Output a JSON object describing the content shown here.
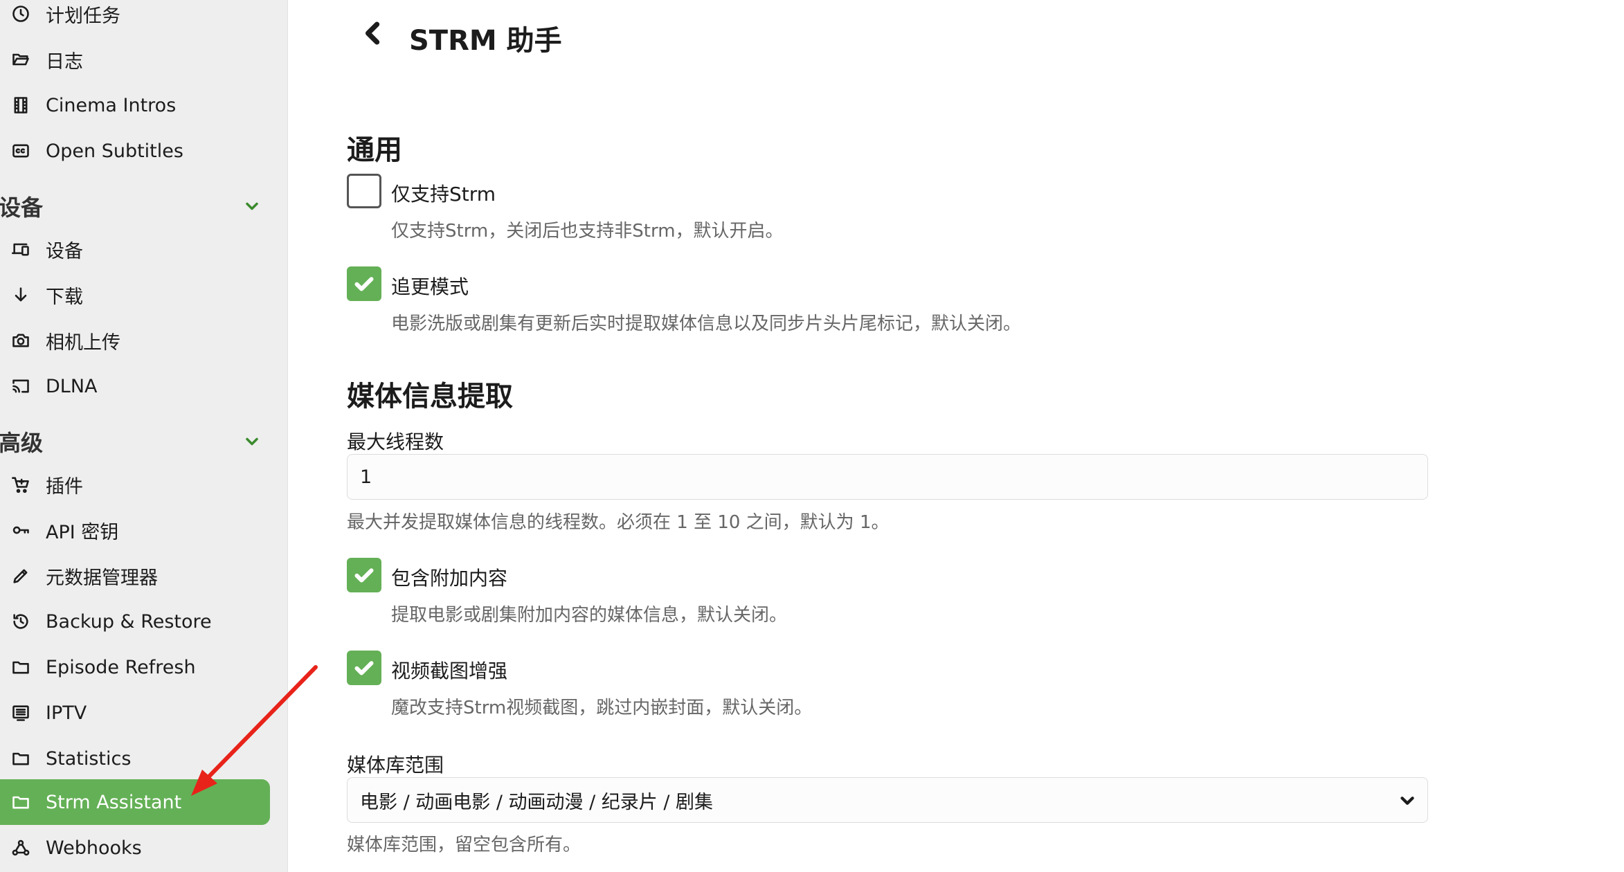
{
  "sidebar": {
    "items": [
      {
        "label": "计划任务",
        "icon": "clock-icon"
      },
      {
        "label": "日志",
        "icon": "folder-open-icon"
      },
      {
        "label": "Cinema Intros",
        "icon": "film-icon"
      },
      {
        "label": "Open Subtitles",
        "icon": "cc-icon"
      },
      {
        "label": "设备",
        "icon": "devices-icon"
      },
      {
        "label": "下载",
        "icon": "download-arrow-icon"
      },
      {
        "label": "相机上传",
        "icon": "camera-icon"
      },
      {
        "label": "DLNA",
        "icon": "cast-icon"
      },
      {
        "label": "插件",
        "icon": "cart-icon"
      },
      {
        "label": "API 密钥",
        "icon": "key-icon"
      },
      {
        "label": "元数据管理器",
        "icon": "pencil-icon"
      },
      {
        "label": "Backup & Restore",
        "icon": "restore-icon"
      },
      {
        "label": "Episode Refresh",
        "icon": "folder-icon"
      },
      {
        "label": "IPTV",
        "icon": "list-icon"
      },
      {
        "label": "Statistics",
        "icon": "folder-icon"
      },
      {
        "label": "Strm Assistant",
        "icon": "folder-icon"
      },
      {
        "label": "Webhooks",
        "icon": "webhook-icon"
      }
    ],
    "sections": {
      "devices": "设备",
      "advanced": "高级"
    },
    "active_item": "Strm Assistant",
    "accent_color": "#64b056"
  },
  "header": {
    "title": "STRM 助手"
  },
  "general": {
    "heading": "通用",
    "strm_only": {
      "label": "仅支持Strm",
      "checked": false,
      "help": "仅支持Strm，关闭后也支持非Strm，默认开启。"
    },
    "catchup_mode": {
      "label": "追更模式",
      "checked": true,
      "help": "电影洗版或剧集有更新后实时提取媒体信息以及同步片头片尾标记，默认关闭。"
    }
  },
  "media_extract": {
    "heading": "媒体信息提取",
    "max_threads": {
      "label": "最大线程数",
      "value": "1",
      "help": "最大并发提取媒体信息的线程数。必须在 1 至 10 之间，默认为 1。"
    },
    "include_extras": {
      "label": "包含附加内容",
      "checked": true,
      "help": "提取电影或剧集附加内容的媒体信息，默认关闭。"
    },
    "video_capture": {
      "label": "视频截图增强",
      "checked": true,
      "help": "魔改支持Strm视频截图，跳过内嵌封面，默认关闭。"
    },
    "library_scope": {
      "label": "媒体库范围",
      "value": "电影 / 动画电影 / 动画动漫 / 纪录片 / 剧集",
      "help": "媒体库范围，留空包含所有。"
    }
  },
  "annotation": {
    "arrow_color": "#e8231a"
  }
}
